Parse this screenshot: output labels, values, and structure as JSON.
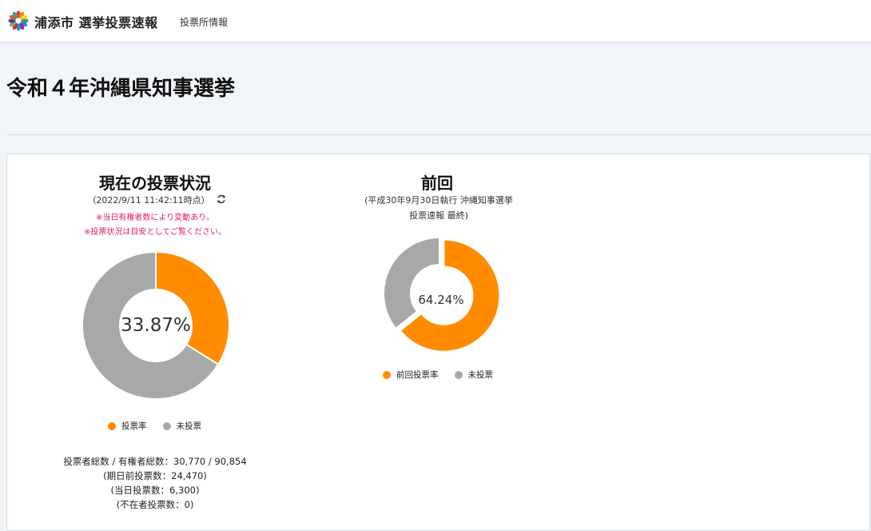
{
  "header": {
    "site_title": "浦添市 選挙投票速報",
    "nav_link": "投票所情報"
  },
  "page_title": "令和４年沖縄県知事選挙",
  "current": {
    "title": "現在の投票状況",
    "timestamp": "（2022/9/11 11:42:11時点）",
    "notice1": "※当日有権者数により変動あり。",
    "notice2": "※投票状況は目安としてご覧ください。",
    "center_label": "33.87%",
    "legend": {
      "voted": "投票率",
      "not_voted": "未投票"
    },
    "stats": {
      "totals": "投票者総数 / 有権者総数：30,770 / 90,854",
      "early": "(期日前投票数：24,470)",
      "same_day": "(当日投票数：6,300)",
      "absentee": "(不在者投票数：0)"
    }
  },
  "previous": {
    "title": "前回",
    "subtitle1": "(平成30年9月30日執行 沖縄知事選挙",
    "subtitle2": "投票速報 最終)",
    "center_label": "64.24%",
    "legend": {
      "voted": "前回投票率",
      "not_voted": "未投票"
    }
  },
  "chart_data": [
    {
      "type": "pie",
      "title": "現在の投票状況",
      "categories": [
        "投票率",
        "未投票"
      ],
      "values": [
        33.87,
        66.13
      ],
      "colors": [
        "#ff8c00",
        "#a8a8a8"
      ]
    },
    {
      "type": "pie",
      "title": "前回",
      "categories": [
        "前回投票率",
        "未投票"
      ],
      "values": [
        64.24,
        35.76
      ],
      "colors": [
        "#ff8c00",
        "#a8a8a8"
      ]
    }
  ],
  "colors": {
    "accent": "#ff8c00",
    "gray": "#a8a8a8",
    "notice": "#e0245e"
  },
  "icons": {
    "logo": "city-emblem-icon",
    "refresh": "refresh-icon"
  }
}
